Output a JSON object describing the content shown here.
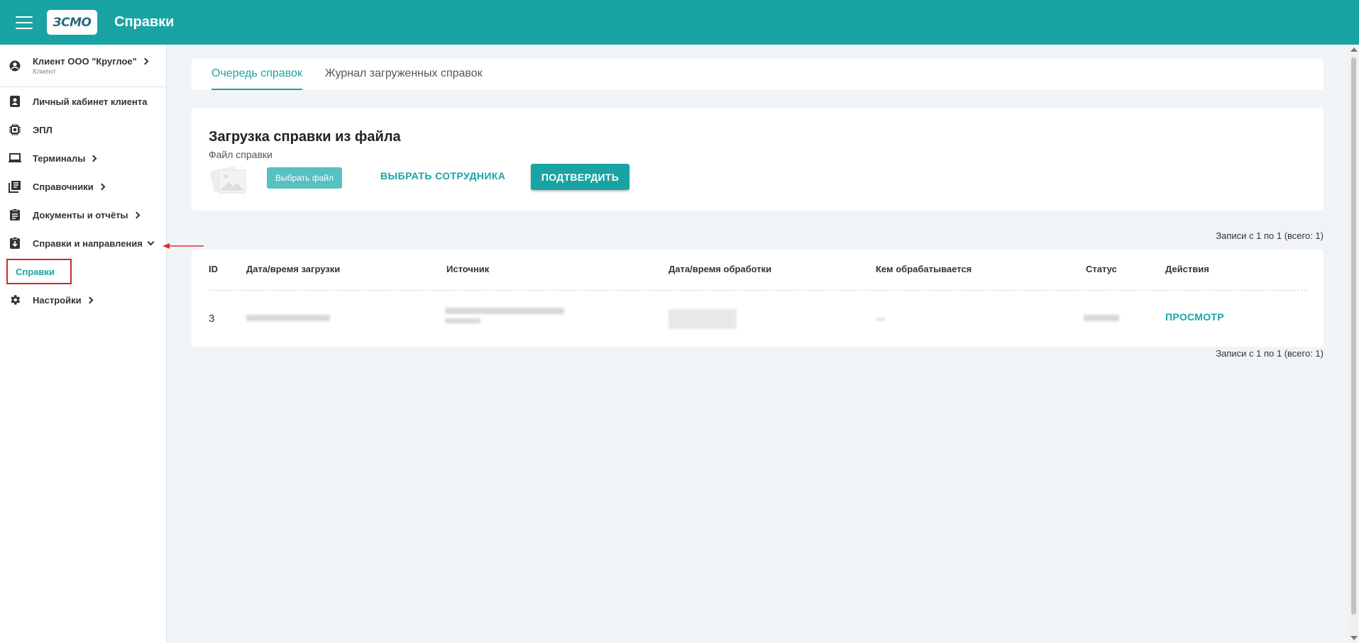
{
  "header": {
    "logo_text": "ЗСМО",
    "title": "Справки"
  },
  "sidebar": {
    "user_name": "Клиент ООО \"Круглое\"",
    "user_role": "Клиент",
    "items": [
      {
        "label": "Личный кабинет клиента",
        "icon": "id-badge-icon"
      },
      {
        "label": "ЭПЛ",
        "icon": "chip-icon"
      },
      {
        "label": "Терминалы",
        "icon": "laptop-icon"
      },
      {
        "label": "Справочники",
        "icon": "book-icon"
      },
      {
        "label": "Документы и отчёты",
        "icon": "clipboard-icon"
      },
      {
        "label": "Справки и направления",
        "icon": "clipboard-download-icon"
      },
      {
        "label": "Настройки",
        "icon": "gear-icon"
      }
    ],
    "sub_item": "Справки"
  },
  "tabs": [
    "Очередь справок",
    "Журнал загруженных справок"
  ],
  "upload": {
    "title": "Загрузка справки из файла",
    "file_label": "Файл справки",
    "choose_file": "Выбрать файл",
    "pick_employee": "ВЫБРАТЬ СОТРУДНИКА",
    "confirm": "ПОДТВЕРДИТЬ"
  },
  "records_info": "Записи с 1 по 1 (всего: 1)",
  "table": {
    "headers": [
      "ID",
      "Дата/время загрузки",
      "Источник",
      "Дата/время обработки",
      "Кем обрабатывается",
      "Статус",
      "Действия"
    ],
    "rows": [
      {
        "id": "3",
        "action": "ПРОСМОТР"
      }
    ]
  },
  "colors": {
    "primary": "#1aa3a3",
    "highlight_border": "#d4262a"
  }
}
